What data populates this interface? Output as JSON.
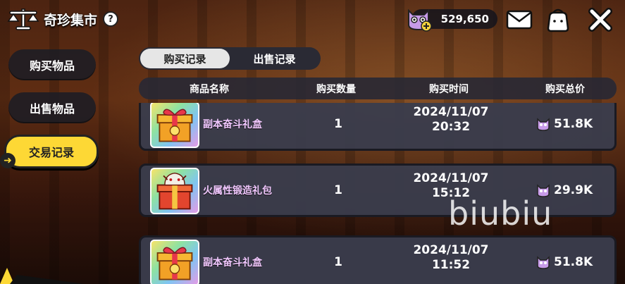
{
  "header": {
    "title": "奇珍集市",
    "help_label": "?",
    "currency_amount": "529,650"
  },
  "nav": {
    "items": [
      {
        "label": "购买物品"
      },
      {
        "label": "出售物品"
      },
      {
        "label": "交易记录"
      }
    ]
  },
  "tabs": [
    {
      "label": "购买记录"
    },
    {
      "label": "出售记录"
    }
  ],
  "table": {
    "columns": [
      "商品名称",
      "购买数量",
      "购买时间",
      "购买总价"
    ],
    "rows": [
      {
        "name": "副本奋斗礼盒",
        "qty": "1",
        "date": "2024/11/07",
        "time": "20:32",
        "price": "51.8K",
        "icon": "gift-box-icon"
      },
      {
        "name": "火属性锻造礼包",
        "qty": "1",
        "date": "2024/11/07",
        "time": "15:12",
        "price": "29.9K",
        "icon": "dragon-gift-icon"
      },
      {
        "name": "副本奋斗礼盒",
        "qty": "1",
        "date": "2024/11/07",
        "time": "11:52",
        "price": "51.8K",
        "icon": "gift-box-icon"
      }
    ]
  },
  "watermark": "biubiu",
  "colors": {
    "accent_yellow": "#fdd835",
    "panel": "#3a3c4c",
    "item_name": "#f2c8ff"
  }
}
